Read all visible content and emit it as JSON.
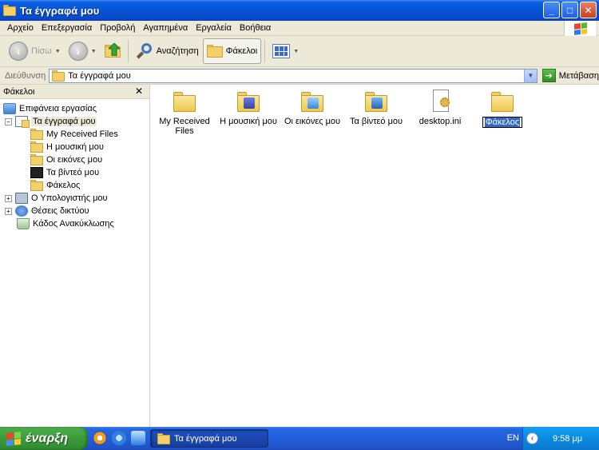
{
  "window": {
    "title": "Τα έγγραφά μου",
    "buttons": {
      "minimize": "_",
      "maximize": "□",
      "close": "✕"
    }
  },
  "menu": [
    "Αρχείο",
    "Επεξεργασία",
    "Προβολή",
    "Αγαπημένα",
    "Εργαλεία",
    "Βοήθεια"
  ],
  "toolbar": {
    "back_label": "Πίσω",
    "search_label": "Αναζήτηση",
    "folders_label": "Φάκελοι"
  },
  "address": {
    "label": "Διεύθυνση",
    "value": "Τα έγγραφά μου",
    "go_label": "Μετάβαση"
  },
  "folders_pane": {
    "title": "Φάκελοι",
    "tree": {
      "desktop": "Επιφάνεια εργασίας",
      "my_documents": "Τα έγγραφά μου",
      "received": "My Received Files",
      "music": "Η μουσική μου",
      "pictures": "Οι εικόνες μου",
      "videos": "Τα βίντεό μου",
      "folder": "Φάκελος",
      "computer": "Ο Υπολογιστής μου",
      "network": "Θέσεις δικτύου",
      "recycle": "Κάδος Ανακύκλωσης"
    }
  },
  "files": {
    "received": "My Received Files",
    "music": "Η μουσική μου",
    "pictures": "Οι εικόνες μου",
    "videos": "Τα βίντεό μου",
    "desktop_ini": "desktop.ini",
    "new_folder": "Φάκελος"
  },
  "taskbar": {
    "start_label": "έναρξη",
    "task_label": "Τα έγγραφά μου",
    "language": "EN",
    "clock": "9:58 μμ"
  },
  "colors": {
    "titlebar": "#0553d6",
    "chrome": "#ece9d8",
    "taskbar": "#245edb",
    "start": "#3c9b3c",
    "selection": "#316ac5"
  }
}
